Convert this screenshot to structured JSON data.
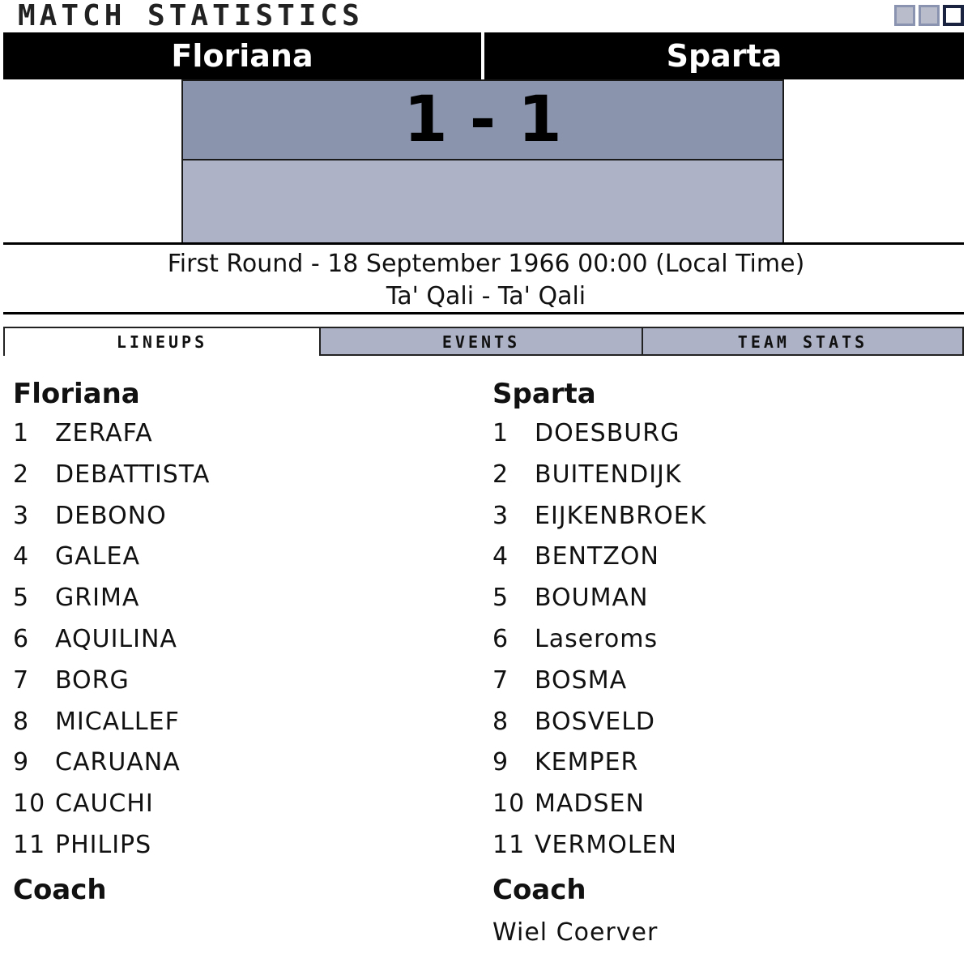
{
  "page": {
    "title": "MATCH STATISTICS"
  },
  "match": {
    "home_team": "Floriana",
    "away_team": "Sparta",
    "score": "1 - 1",
    "info_line": "First Round - 18 September 1966 00:00 (Local Time)",
    "venue_line": "Ta' Qali - Ta' Qali"
  },
  "tabs": [
    {
      "label": "LINEUPS",
      "active": true
    },
    {
      "label": "EVENTS",
      "active": false
    },
    {
      "label": "TEAM STATS",
      "active": false
    }
  ],
  "lineups": {
    "home": {
      "team": "Floriana",
      "players": [
        {
          "num": "1",
          "name": "ZERAFA"
        },
        {
          "num": "2",
          "name": "DEBATTISTA"
        },
        {
          "num": "3",
          "name": "DEBONO"
        },
        {
          "num": "4",
          "name": "GALEA"
        },
        {
          "num": "5",
          "name": "GRIMA"
        },
        {
          "num": "6",
          "name": "AQUILINA"
        },
        {
          "num": "7",
          "name": "BORG"
        },
        {
          "num": "8",
          "name": "MICALLEF"
        },
        {
          "num": "9",
          "name": "CARUANA"
        },
        {
          "num": "10",
          "name": "CAUCHI"
        },
        {
          "num": "11",
          "name": "PHILIPS"
        }
      ],
      "coach_heading": "Coach",
      "coach": ""
    },
    "away": {
      "team": "Sparta",
      "players": [
        {
          "num": "1",
          "name": "DOESBURG"
        },
        {
          "num": "2",
          "name": "BUITENDIJK"
        },
        {
          "num": "3",
          "name": "EIJKENBROEK"
        },
        {
          "num": "4",
          "name": "BENTZON"
        },
        {
          "num": "5",
          "name": "BOUMAN"
        },
        {
          "num": "6",
          "name": "Laseroms"
        },
        {
          "num": "7",
          "name": "BOSMA"
        },
        {
          "num": "8",
          "name": "BOSVELD"
        },
        {
          "num": "9",
          "name": "KEMPER"
        },
        {
          "num": "10",
          "name": "MADSEN"
        },
        {
          "num": "11",
          "name": "VERMOLEN"
        }
      ],
      "coach_heading": "Coach",
      "coach": "Wiel Coerver"
    }
  },
  "colors": {
    "team_bar": "#000000",
    "score_box": "#8a94ad",
    "score_sub": "#adb2c6",
    "tab_inactive": "#adb2c6"
  }
}
